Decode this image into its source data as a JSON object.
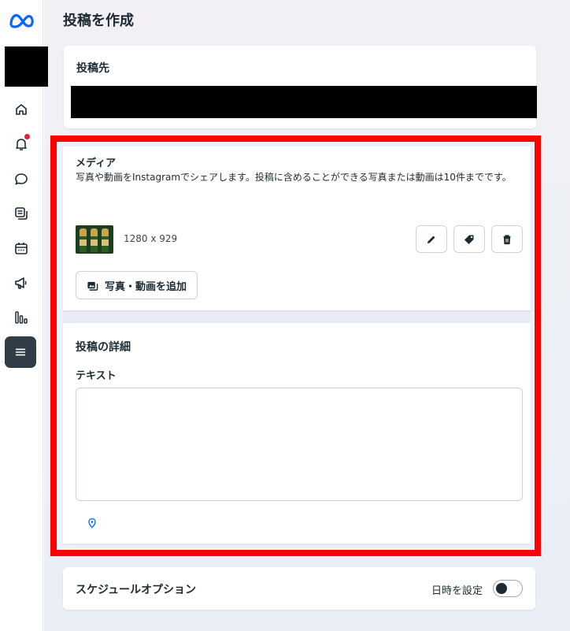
{
  "page": {
    "title": "投稿を作成"
  },
  "sidebar": {
    "items": [
      {
        "icon": "home-icon"
      },
      {
        "icon": "bell-icon"
      },
      {
        "icon": "chat-icon"
      },
      {
        "icon": "posts-icon"
      },
      {
        "icon": "calendar-icon"
      },
      {
        "icon": "megaphone-icon"
      },
      {
        "icon": "insights-icon"
      },
      {
        "icon": "menu-icon"
      }
    ],
    "active_color": "#2f3d47",
    "notification_color": "#e41e3f"
  },
  "destination": {
    "title": "投稿先"
  },
  "media": {
    "title": "メディア",
    "description": "写真や動画をInstagramでシェアします。投稿に含めることができる写真または動画は10件までです。",
    "item_dimensions": "1280 x 929",
    "add_button_label": "写真・動画を追加",
    "actions": [
      "edit-icon",
      "tag-icon",
      "trash-icon"
    ]
  },
  "details": {
    "title": "投稿の詳細",
    "text_label": "テキスト",
    "text_value": "",
    "hashtag_symbol": "#"
  },
  "schedule": {
    "title": "スケジュールオプション",
    "set_datetime_label": "日時を設定",
    "enabled": false
  },
  "colors": {
    "highlight_frame": "#ff0000",
    "meta_blue": "#0866ff"
  }
}
